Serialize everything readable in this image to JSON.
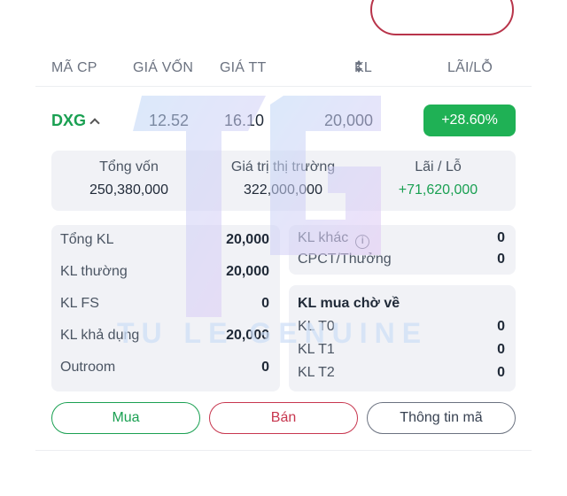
{
  "header": {
    "ma_cp": "MÃ CP",
    "gia_von": "GIÁ VỐN",
    "gia_tt": "GIÁ TT",
    "kl": "KL",
    "lai_lo": "LÃI/LỖ"
  },
  "position": {
    "code": "DXG",
    "gia_von": "12.52",
    "gia_tt": "16.10",
    "kl": "20,000",
    "lai_lo_pct": "+28.60%"
  },
  "summary": {
    "tong_von_label": "Tổng vốn",
    "tong_von_value": "250,380,000",
    "gia_tri_label": "Giá trị thị trường",
    "gia_tri_value": "322,000,000",
    "lai_lo_label": "Lãi / Lỗ",
    "lai_lo_value": "+71,620,000"
  },
  "left_panel": {
    "items": [
      {
        "label": "Tổng KL",
        "value": "20,000"
      },
      {
        "label": "KL thường",
        "value": "20,000"
      },
      {
        "label": "KL FS",
        "value": "0"
      },
      {
        "label": "KL khả dụng",
        "value": "20,000"
      },
      {
        "label": "Outroom",
        "value": "0"
      }
    ]
  },
  "right_top": {
    "items": [
      {
        "label": "KL khác",
        "value": "0"
      },
      {
        "label": "CPCT/Thưởng",
        "value": "0"
      }
    ]
  },
  "right_bottom": {
    "title": "KL mua chờ về",
    "items": [
      {
        "label": "KL T0",
        "value": "0"
      },
      {
        "label": "KL T1",
        "value": "0"
      },
      {
        "label": "KL T2",
        "value": "0"
      }
    ]
  },
  "buttons": {
    "buy": "Mua",
    "sell": "Bán",
    "info": "Thông tin mã"
  },
  "watermark": {
    "logo_text": "TU LE GENUINE"
  },
  "colors": {
    "green": "#1aa052",
    "positive_badge": "#1fb155",
    "red": "#c7364e",
    "panel_bg": "#f1f2f6"
  }
}
